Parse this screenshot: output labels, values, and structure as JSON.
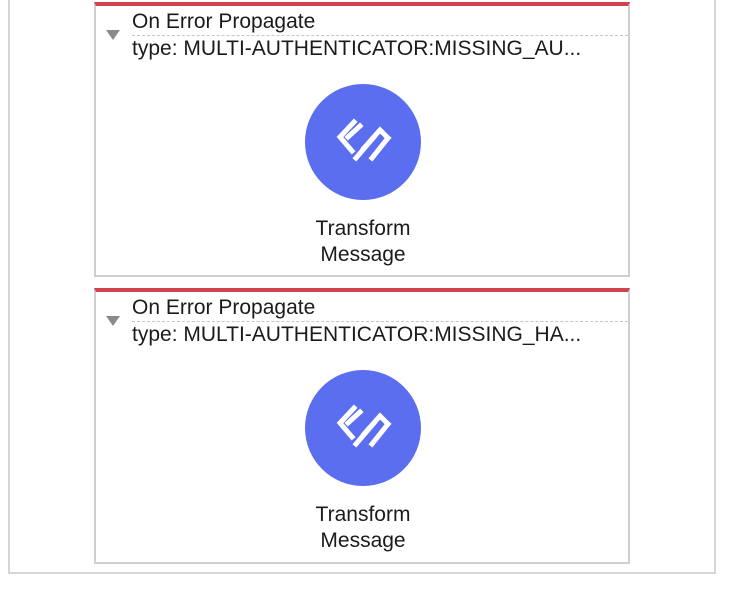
{
  "handlers": [
    {
      "title": "On Error Propagate",
      "type": "type: MULTI-AUTHENTICATOR:MISSING_AU...",
      "component": {
        "line1": "Transform",
        "line2": "Message",
        "icon": "dataweave-icon"
      }
    },
    {
      "title": "On Error Propagate",
      "type": "type: MULTI-AUTHENTICATOR:MISSING_HA...",
      "component": {
        "line1": "Transform",
        "line2": "Message",
        "icon": "dataweave-icon"
      }
    }
  ],
  "colors": {
    "accent_top_border": "#d1434f",
    "component_circle": "#5c6ef0"
  }
}
